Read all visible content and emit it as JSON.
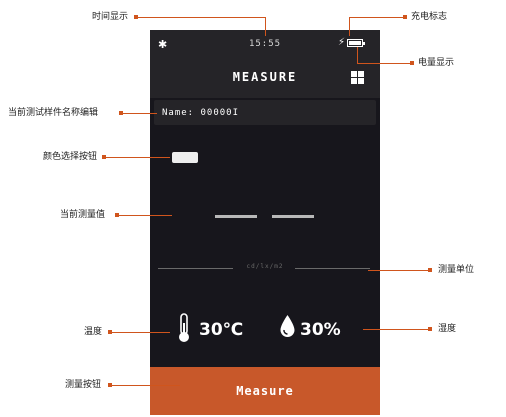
{
  "phone": {
    "status_time": "15:55",
    "title": "MEASURE",
    "name_field": "Name: 00000I",
    "unit": "cd/lx/m2",
    "temperature": "30℃",
    "humidity": "30%",
    "measure_button": "Measure",
    "icons": [
      "bluetooth-icon",
      "charging-bolt-icon",
      "battery-icon",
      "grid-menu-icon",
      "thermometer-icon",
      "water-drop-icon"
    ]
  },
  "annotations": {
    "time_display": "时间显示",
    "charging_indicator": "充电标志",
    "battery_display": "电量显示",
    "sample_name_edit": "当前测试样件名称编辑",
    "color_select_button": "颜色选择按钮",
    "current_value": "当前测量值",
    "measure_unit": "测量单位",
    "temperature": "温度",
    "humidity": "湿度",
    "measure_button": "测量按钮"
  },
  "colors": {
    "accent_orange": "#c8582a",
    "leader_line": "#d0551d",
    "screen_bg": "#17161c",
    "bar_bg": "#252428"
  }
}
